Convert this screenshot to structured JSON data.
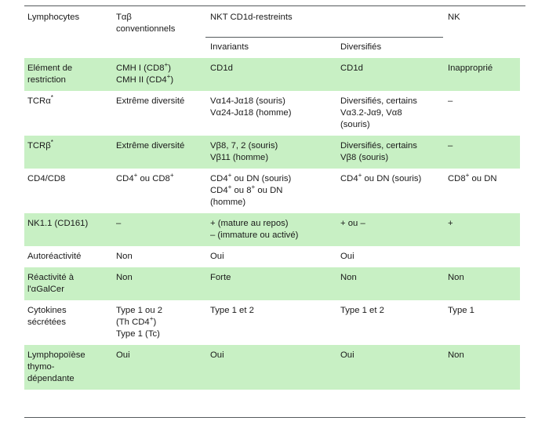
{
  "table": {
    "header": {
      "col1": "Lymphocytes",
      "col2": "Tαβ\nconventionnels",
      "group_nkt": "NKT CD1d-restreints",
      "col5": "NK",
      "sub_col3": "Invariants",
      "sub_col4": "Diversifiés"
    },
    "rows": [
      {
        "shaded": true,
        "label": "Elément de\nrestriction",
        "c2_html": "CMH I (CD8<sup>+</sup>)\nCMH II (CD4<sup>+</sup>)",
        "c3_html": "CD1d",
        "c4_html": "CD1d",
        "c5_html": "Inapproprié"
      },
      {
        "shaded": false,
        "label": "TCRα<sup>*</sup>",
        "c2_html": "Extrême diversité",
        "c3_html": "Vα14-Jα18 (souris)\nVα24-Jα18 (homme)",
        "c4_html": "Diversifiés, certains\nVα3.2-Jα9, Vα8\n(souris)",
        "c5_html": "–"
      },
      {
        "shaded": true,
        "label": "TCRβ<sup>*</sup>",
        "c2_html": "Extrême diversité",
        "c3_html": "Vβ8, 7, 2 (souris)\nVβ11 (homme)",
        "c4_html": "Diversifiés, certains\nVβ8 (souris)",
        "c5_html": "–"
      },
      {
        "shaded": false,
        "label": "CD4/CD8",
        "c2_html": "CD4<sup>+</sup> ou CD8<sup>+</sup>",
        "c3_html": "CD4<sup>+</sup> ou DN (souris)\nCD4<sup>+</sup> ou 8<sup>+</sup> ou DN\n(homme)",
        "c4_html": "CD4<sup>+</sup> ou DN (souris)",
        "c5_html": "CD8<sup>+</sup> ou DN"
      },
      {
        "shaded": true,
        "label": "NK1.1 (CD161)",
        "c2_html": "–",
        "c3_html": "+ (mature au repos)\n– (immature ou activé)",
        "c4_html": "+ ou –",
        "c5_html": "+"
      },
      {
        "shaded": false,
        "label": "Autoréactivité",
        "c2_html": "Non",
        "c3_html": "Oui",
        "c4_html": "Oui",
        "c5_html": ""
      },
      {
        "shaded": true,
        "label": "Réactivité à\nl'αGalCer",
        "c2_html": "Non",
        "c3_html": "Forte",
        "c4_html": "Non",
        "c5_html": "Non"
      },
      {
        "shaded": false,
        "label": "Cytokines\nsécrétées",
        "c2_html": "Type 1 ou 2\n(Th CD4<sup>+</sup>)\nType 1 (Tc)",
        "c3_html": "Type 1 et 2",
        "c4_html": "Type 1 et 2",
        "c5_html": "Type 1"
      },
      {
        "shaded": true,
        "label": "Lymphopoïèse\nthymo-\ndépendante",
        "c2_html": "Oui",
        "c3_html": "Oui",
        "c4_html": "Oui",
        "c5_html": "Non"
      }
    ],
    "colors": {
      "shaded_row": "#c8f0c4",
      "rule": "#555a5d",
      "text": "#1a1a1a"
    }
  }
}
